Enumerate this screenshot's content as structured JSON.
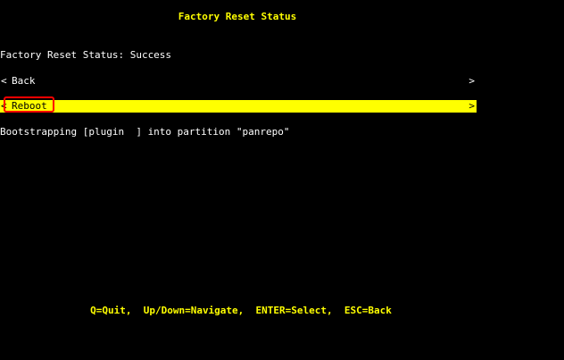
{
  "screen": {
    "title": "Factory Reset Status",
    "status_line": "Factory Reset Status: Success",
    "log_line": "Bootstrapping [plugin  ] into partition \"panrepo\"",
    "footer_help": "Q=Quit,  Up/Down=Navigate,  ENTER=Select,  ESC=Back"
  },
  "menu": {
    "left_arrow": "<",
    "right_arrow": ">",
    "items": [
      {
        "label": "Back",
        "selected": false
      },
      {
        "label": "Reboot",
        "selected": true
      }
    ]
  },
  "colors": {
    "background": "#000000",
    "text": "#ffffff",
    "accent": "#ffff00",
    "selection_text": "#000000",
    "highlight_box": "#ff0000"
  }
}
